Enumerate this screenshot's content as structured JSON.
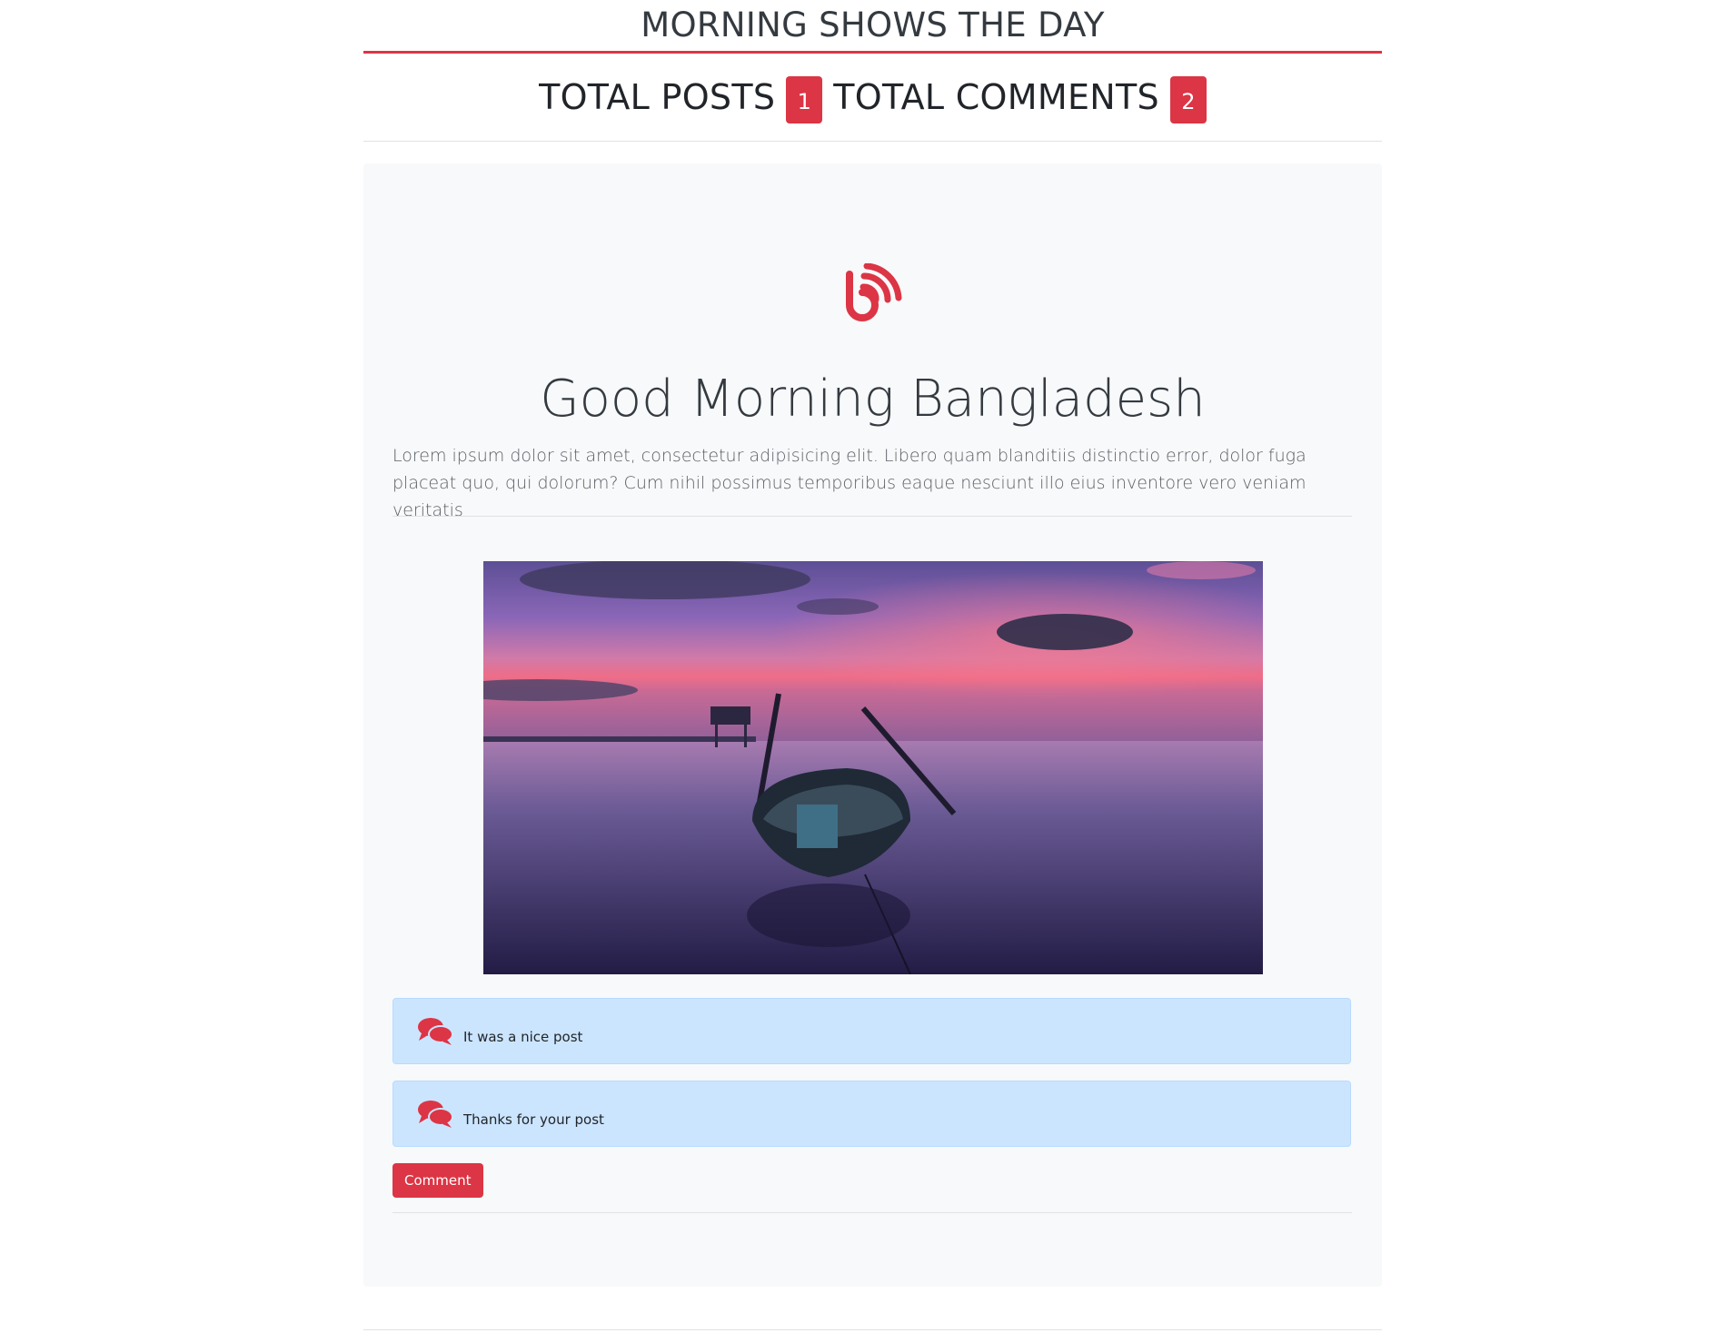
{
  "header": {
    "site_title": "MORNING SHOWS THE DAY",
    "total_posts_label": "TOTAL POSTS",
    "total_posts_count": "1",
    "total_comments_label": "TOTAL COMMENTS",
    "total_comments_count": "2"
  },
  "post": {
    "icon": "blog-icon",
    "title": "Good Morning Bangladesh",
    "body": "Lorem ipsum dolor sit amet, consectetur adipisicing elit. Libero quam blanditiis distinctio error, dolor fuga placeat quo, qui dolorum? Cum nihil possimus temporibus eaque nesciunt illo eius inventore vero veniam veritatis",
    "image": "sunset-boat-photo"
  },
  "comments": [
    {
      "icon": "comments-icon",
      "text": "It was a nice post"
    },
    {
      "icon": "comments-icon",
      "text": "Thanks for your post"
    }
  ],
  "actions": {
    "comment_button_label": "Comment"
  },
  "colors": {
    "accent": "#dc3545",
    "comment_bg": "#cce5ff",
    "panel_bg": "#f8f9fa"
  }
}
